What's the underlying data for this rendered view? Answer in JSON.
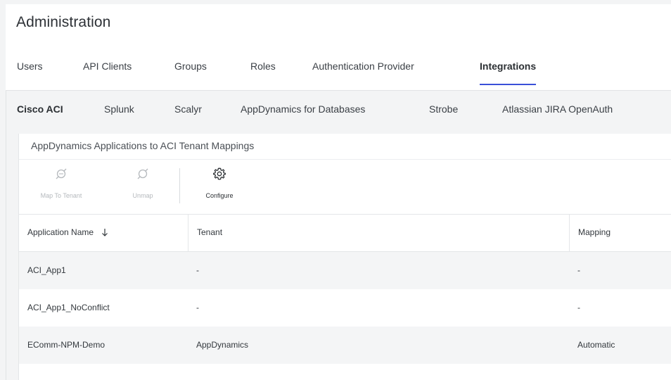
{
  "page": {
    "title": "Administration"
  },
  "main_tabs": [
    {
      "label": "Users",
      "active": false
    },
    {
      "label": "API Clients",
      "active": false
    },
    {
      "label": "Groups",
      "active": false
    },
    {
      "label": "Roles",
      "active": false
    },
    {
      "label": "Authentication Provider",
      "active": false
    },
    {
      "label": "Integrations",
      "active": true
    }
  ],
  "sub_tabs": [
    {
      "label": "Cisco ACI",
      "active": true
    },
    {
      "label": "Splunk",
      "active": false
    },
    {
      "label": "Scalyr",
      "active": false
    },
    {
      "label": "AppDynamics for Databases",
      "active": false
    },
    {
      "label": "Strobe",
      "active": false
    },
    {
      "label": "Atlassian JIRA OpenAuth",
      "active": false
    }
  ],
  "panel": {
    "title": "AppDynamics Applications to ACI Tenant Mappings"
  },
  "toolbar": {
    "map_label": "Map To Tenant",
    "unmap_label": "Unmap",
    "configure_label": "Configure"
  },
  "table": {
    "columns": [
      "Application Name",
      "Tenant",
      "Mapping"
    ],
    "sort_column": "Application Name",
    "rows": [
      [
        "ACI_App1",
        "-",
        "-"
      ],
      [
        "ACI_App1_NoConflict",
        "-",
        "-"
      ],
      [
        "EComm-NPM-Demo",
        "AppDynamics",
        "Automatic"
      ]
    ]
  },
  "colors": {
    "accent": "#3a50d8",
    "disabled": "#b5b9bd"
  }
}
